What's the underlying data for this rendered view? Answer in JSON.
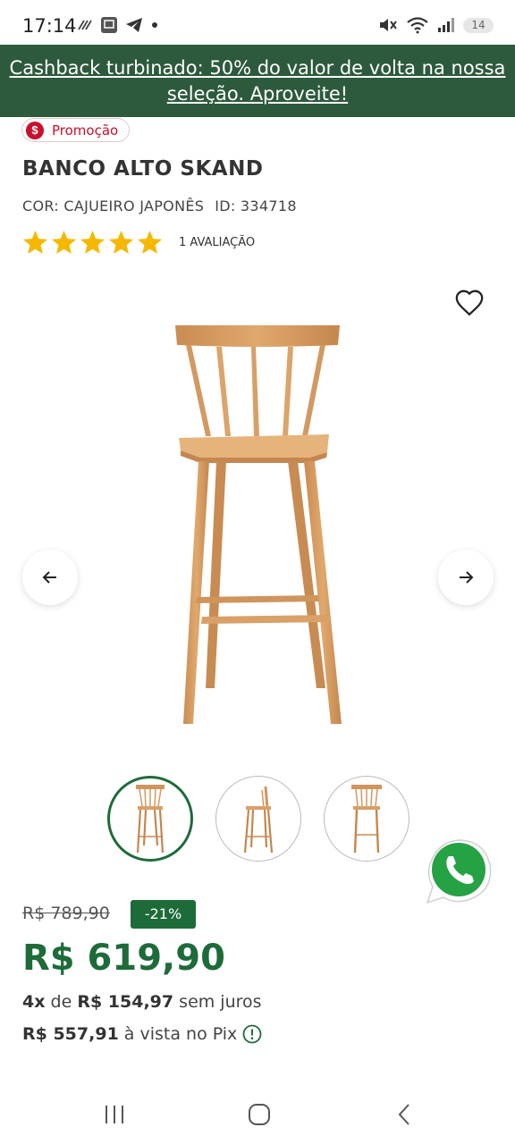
{
  "status_bar": {
    "time": "17:14",
    "battery": "14",
    "icons": [
      "signal-lines-icon",
      "app-icon",
      "telegram-icon",
      "dot-icon",
      "mute-icon",
      "wifi-icon",
      "cellular-icon",
      "battery-icon"
    ]
  },
  "promo_banner": {
    "text": "Cashback turbinado: 50% do valor de volta na nossa seleção. Aproveite!"
  },
  "badge": {
    "symbol": "$",
    "label": "Promoção"
  },
  "product": {
    "title": "BANCO ALTO SKAND",
    "color": "COR: CAJUEIRO JAPONÊS",
    "id": "ID: 334718",
    "rating": {
      "stars": 5,
      "max": 5,
      "count_label": "1 AVALIAÇÃO"
    },
    "thumbnails": 3,
    "active_thumbnail": 1
  },
  "pricing": {
    "old_price": "R$ 789,90",
    "discount": "-21%",
    "price": "R$ 619,90",
    "installments_prefix": "4x",
    "installments_de": "de",
    "installments_value": "R$ 154,97",
    "installments_suffix": "sem juros",
    "pix_value": "R$ 557,91",
    "pix_suffix": "à vista no Pix"
  },
  "colors": {
    "banner_green": "#2d5a3c",
    "price_green": "#1e6b3a",
    "promo_red": "#c8102e",
    "star_yellow": "#f5b800",
    "whatsapp_green": "#25a244"
  }
}
